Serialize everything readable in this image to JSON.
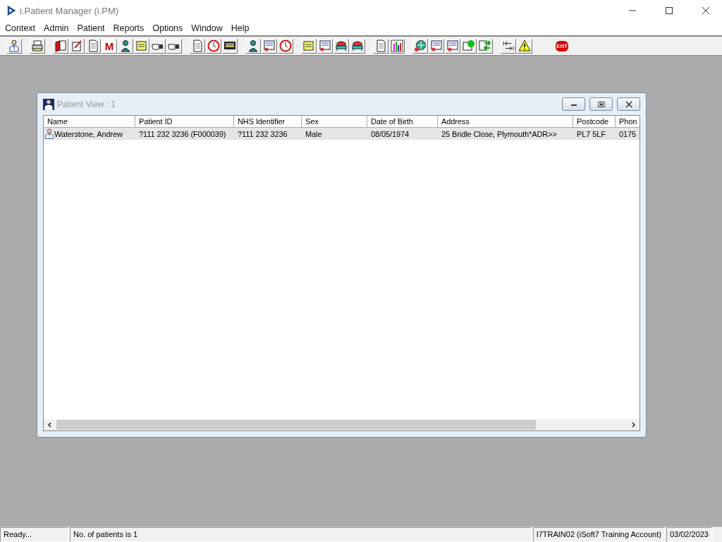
{
  "window": {
    "title": "i.Patient Manager (i.PM)"
  },
  "menu": [
    "Context",
    "Admin",
    "Patient",
    "Reports",
    "Options",
    "Window",
    "Help"
  ],
  "toolbar": {
    "m_button_label": "M",
    "exit_button_label": "EXIT"
  },
  "child_window": {
    "title": "Patient View : 1",
    "table": {
      "columns": [
        "Name",
        "Patient ID",
        "NHS Identifier",
        "Sex",
        "Date of Birth",
        "Address",
        "Postcode",
        "Phon"
      ],
      "rows": [
        {
          "selected": true,
          "cells": [
            "Waterstone, Andrew",
            "?111 232 3236 (F000039)",
            "?111 232 3236",
            "Male",
            "08/05/1974",
            "25 Bridle Close, Plymouth*ADR>>",
            "PL7 5LF",
            "0175"
          ]
        }
      ]
    }
  },
  "status_bar": [
    "Ready...",
    "No. of patients is 1",
    "I7TRAIN02 (iSoft7 Training Account)",
    "03/02/2023"
  ]
}
